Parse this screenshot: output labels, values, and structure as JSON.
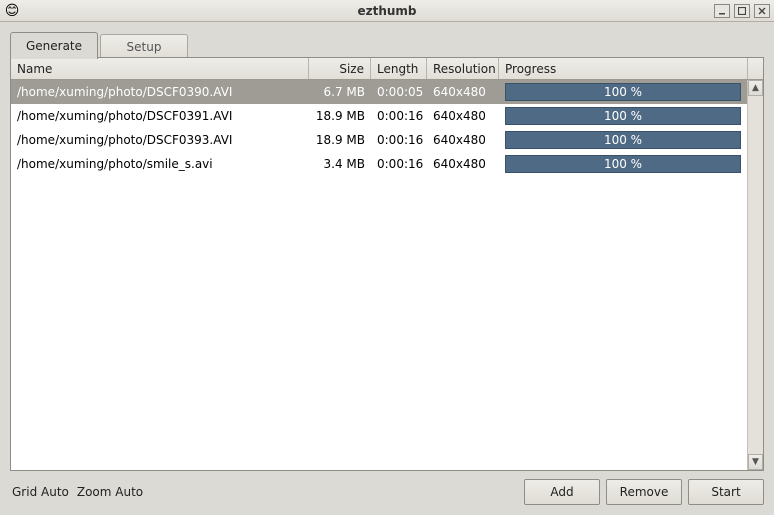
{
  "window": {
    "title": "ezthumb",
    "icon_glyph": "😊"
  },
  "tabs": {
    "generate": "Generate",
    "setup": "Setup",
    "active": "generate"
  },
  "columns": {
    "name": "Name",
    "size": "Size",
    "length": "Length",
    "resolution": "Resolution",
    "progress": "Progress"
  },
  "rows": [
    {
      "name": "/home/xuming/photo/DSCF0390.AVI",
      "size": "6.7 MB",
      "length": "0:00:05",
      "resolution": "640x480",
      "progress": "100 %",
      "selected": true
    },
    {
      "name": "/home/xuming/photo/DSCF0391.AVI",
      "size": "18.9 MB",
      "length": "0:00:16",
      "resolution": "640x480",
      "progress": "100 %",
      "selected": false
    },
    {
      "name": "/home/xuming/photo/DSCF0393.AVI",
      "size": "18.9 MB",
      "length": "0:00:16",
      "resolution": "640x480",
      "progress": "100 %",
      "selected": false
    },
    {
      "name": "/home/xuming/photo/smile_s.avi",
      "size": "3.4 MB",
      "length": "0:00:16",
      "resolution": "640x480",
      "progress": "100 %",
      "selected": false
    }
  ],
  "status": {
    "grid": "Grid Auto",
    "zoom": "Zoom Auto"
  },
  "buttons": {
    "add": "Add",
    "remove": "Remove",
    "start": "Start"
  }
}
